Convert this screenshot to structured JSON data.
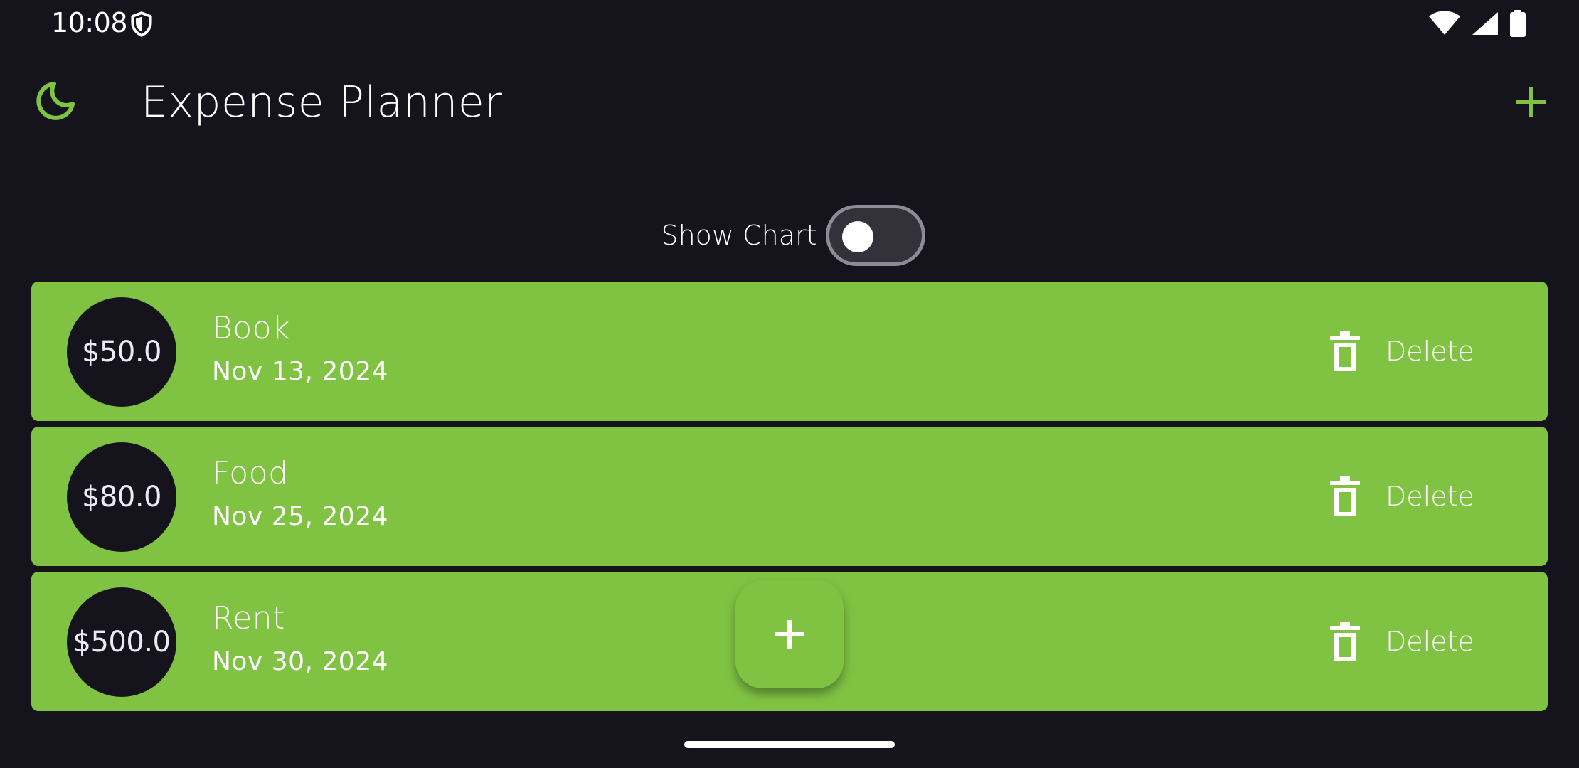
{
  "status_bar": {
    "time": "10:08"
  },
  "app_bar": {
    "title": "Expense Planner"
  },
  "chart_toggle": {
    "label": "Show Chart",
    "on": false
  },
  "expenses": [
    {
      "amount": "$50.0",
      "title": "Book",
      "date": "Nov 13, 2024",
      "action": "Delete"
    },
    {
      "amount": "$80.0",
      "title": "Food",
      "date": "Nov 25, 2024",
      "action": "Delete"
    },
    {
      "amount": "$500.0",
      "title": "Rent",
      "date": "Nov 30, 2024",
      "action": "Delete"
    }
  ],
  "colors": {
    "background": "#15131b",
    "accent": "#80c343",
    "text": "#ffffff"
  },
  "icons": {
    "status": [
      "shield-icon",
      "wifi-icon",
      "cellular-signal-icon",
      "battery-icon"
    ],
    "app_bar": [
      "dark-mode-moon-icon",
      "add-icon"
    ],
    "item": "trash-icon",
    "fab": "add-icon"
  }
}
